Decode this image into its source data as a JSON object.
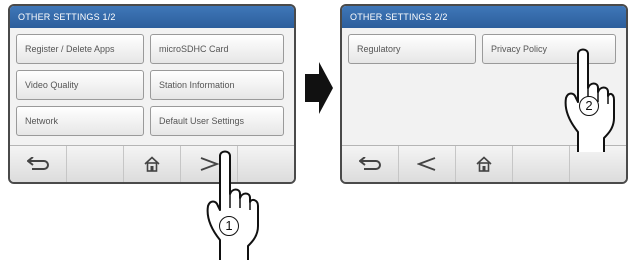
{
  "screen1": {
    "title": "OTHER SETTINGS  1/2",
    "buttons": [
      "Register / Delete Apps",
      "microSDHC Card",
      "Video Quality",
      "Station Information",
      "Network",
      "Default User Settings"
    ]
  },
  "screen2": {
    "title": "OTHER SETTINGS  2/2",
    "buttons": [
      "Regulatory",
      "Privacy Policy"
    ]
  },
  "step_numbers": [
    "1",
    "2"
  ],
  "icons": {
    "back": "back-arrow-icon",
    "home": "home-icon",
    "next": "next-page-icon",
    "prev": "previous-page-icon",
    "pointer": "pointing-hand-icon",
    "flow": "flow-arrow-icon"
  },
  "colors": {
    "title_bar": "#2c5e9c",
    "frame": "#4a4a4a"
  }
}
